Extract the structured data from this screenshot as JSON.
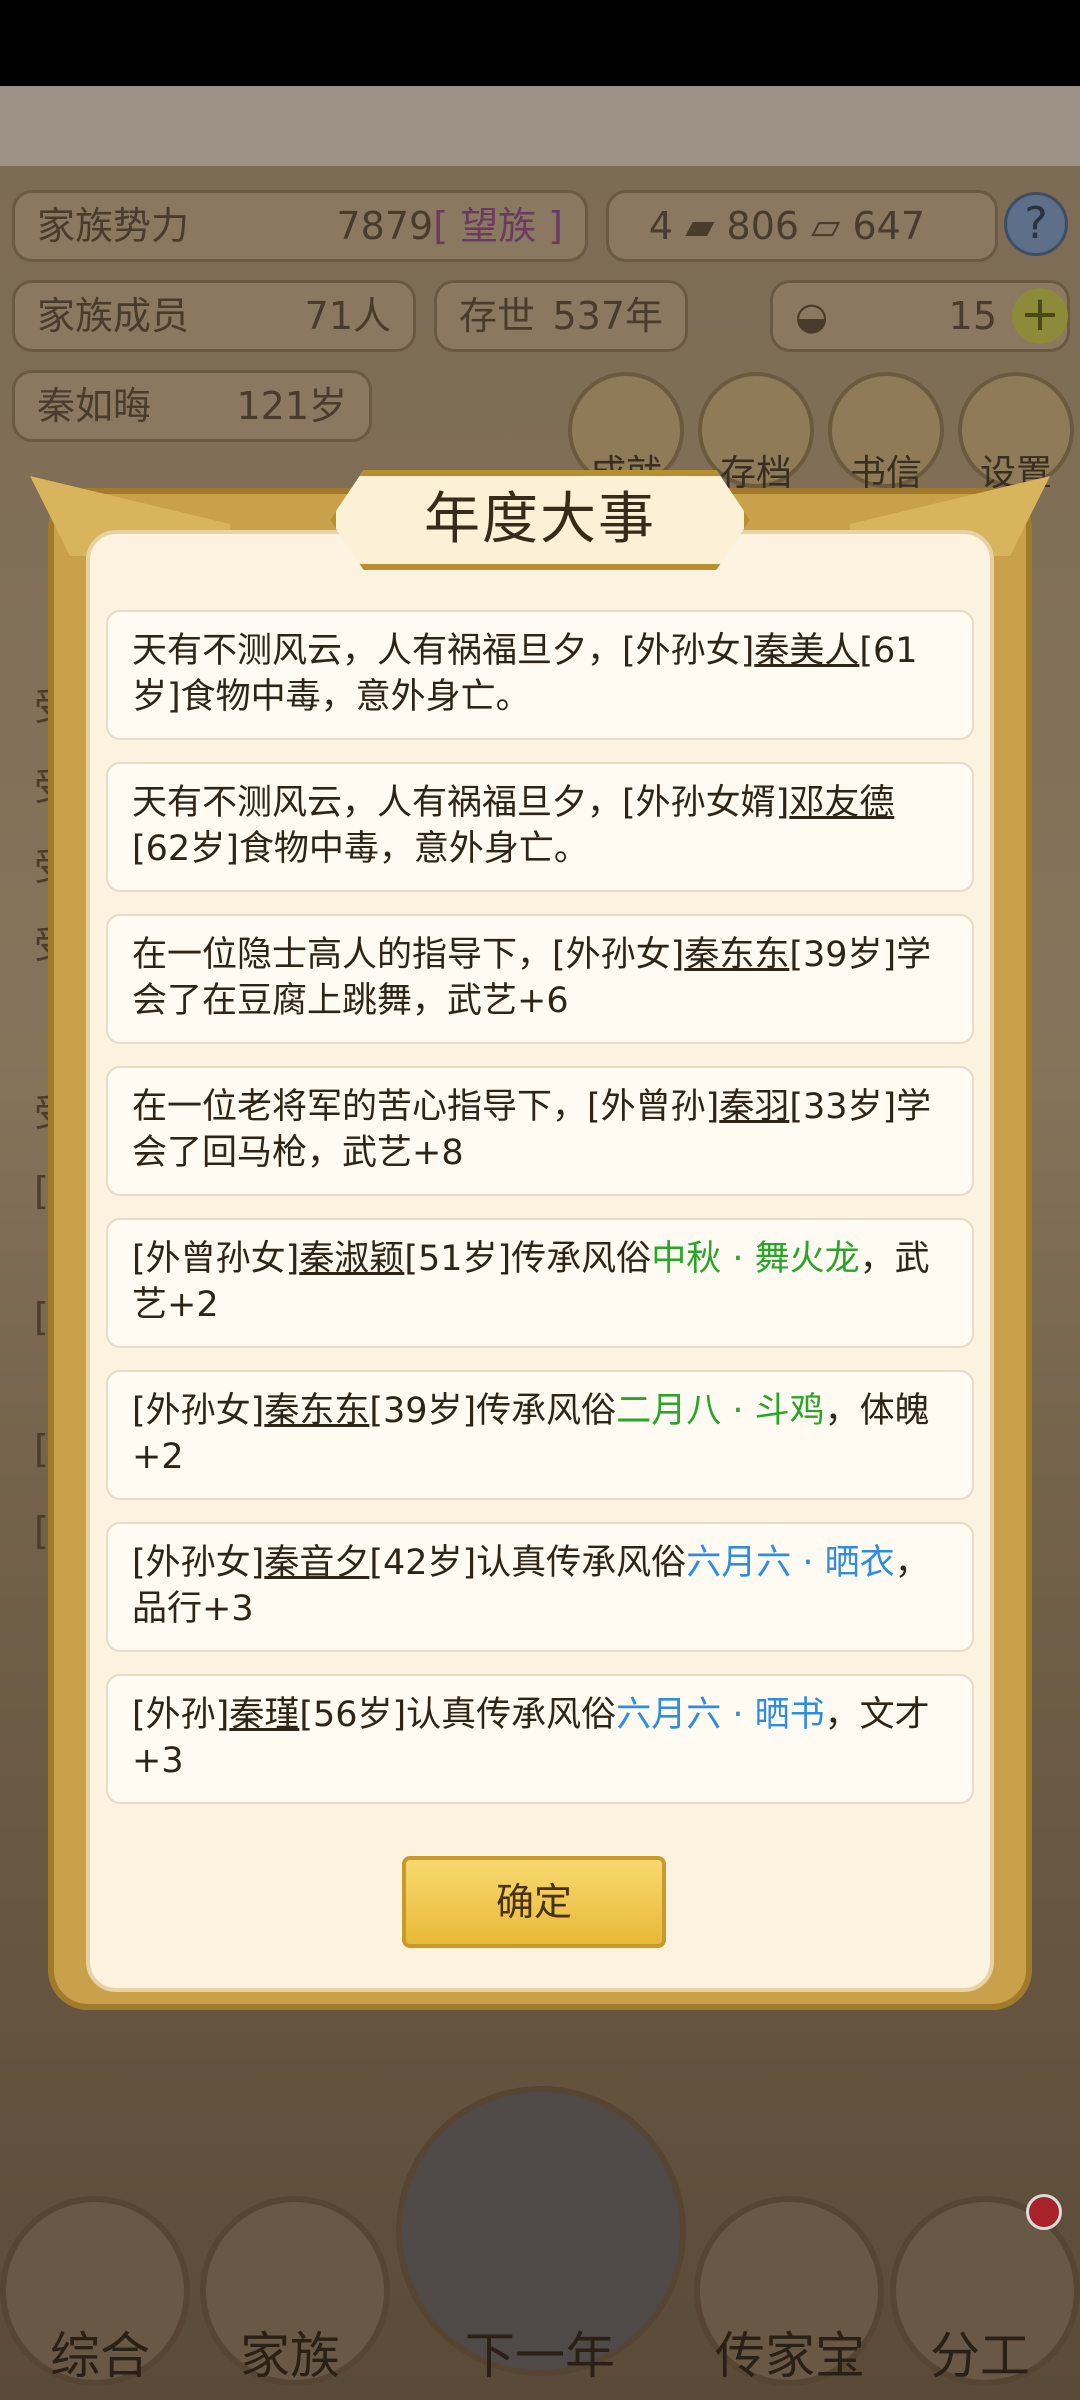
{
  "background": {
    "family_power_label": "家族势力",
    "family_power_value": "7879",
    "family_power_rank": "[ 望族 ]",
    "currency_1": "4",
    "currency_2": "806",
    "currency_3": "647",
    "family_members_label": "家族成员",
    "family_members_value": "71人",
    "existence_label": "存世",
    "existence_value": "537年",
    "gold_value": "15",
    "patriarch_name": "秦如晦",
    "patriarch_age": "121岁",
    "top_buttons": [
      "成就",
      "存档",
      "书信",
      "设置"
    ],
    "side_left": [
      "受",
      "受",
      "受",
      "受",
      "受",
      "[家",
      "[家",
      "[家",
      "[家"
    ],
    "bottom_nav": [
      "综合",
      "家族",
      "下一年",
      "传家宝",
      "分工"
    ]
  },
  "dialog": {
    "title": "年度大事",
    "events": [
      {
        "pre": "天有不测风云，人有祸福旦夕，[外孙女]",
        "name": "秦美人",
        "post": "[61岁]食物中毒，意外身亡。",
        "custom": "",
        "custom_color": "",
        "tail": ""
      },
      {
        "pre": "天有不测风云，人有祸福旦夕，[外孙女婿]",
        "name": "邓友德",
        "post": "[62岁]食物中毒，意外身亡。",
        "custom": "",
        "custom_color": "",
        "tail": ""
      },
      {
        "pre": "在一位隐士高人的指导下，[外孙女]",
        "name": "秦东东",
        "post": "[39岁]学会了在豆腐上跳舞，武艺+6",
        "custom": "",
        "custom_color": "",
        "tail": ""
      },
      {
        "pre": "在一位老将军的苦心指导下，[外曾孙]",
        "name": "秦羽",
        "post": "[33岁]学会了回马枪，武艺+8",
        "custom": "",
        "custom_color": "",
        "tail": ""
      },
      {
        "pre": "[外曾孙女]",
        "name": "秦淑颖",
        "post": "[51岁]传承风俗",
        "custom": "中秋 · 舞火龙",
        "custom_color": "green",
        "tail": "，武艺+2"
      },
      {
        "pre": "[外孙女]",
        "name": "秦东东",
        "post": "[39岁]传承风俗",
        "custom": "二月八 · 斗鸡",
        "custom_color": "green",
        "tail": "，体魄+2"
      },
      {
        "pre": "[外孙女]",
        "name": "秦音夕",
        "post": "[42岁]认真传承风俗",
        "custom": "六月六 · 晒衣",
        "custom_color": "blue",
        "tail": "，品行+3"
      },
      {
        "pre": "[外孙]",
        "name": "秦瑾",
        "post": "[56岁]认真传承风俗",
        "custom": "六月六 · 晒书",
        "custom_color": "blue",
        "tail": "，文才+3"
      }
    ],
    "confirm_label": "确定"
  }
}
